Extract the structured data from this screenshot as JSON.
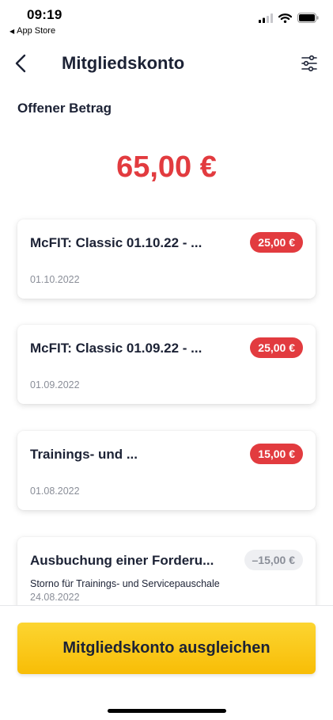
{
  "status_bar": {
    "time": "09:19",
    "back_app": "App Store",
    "icons": [
      "cellular-signal-icon",
      "wifi-icon",
      "battery-icon"
    ]
  },
  "nav": {
    "title": "Mitgliedskonto",
    "back_icon": "chevron-left-icon",
    "filter_icon": "sliders-icon"
  },
  "summary": {
    "label": "Offener Betrag",
    "amount": "65,00 €"
  },
  "transactions": [
    {
      "title": "McFIT: Classic 01.10.22 - ...",
      "amount": "25,00 €",
      "date": "01.10.2022",
      "status": "open"
    },
    {
      "title": "McFIT: Classic 01.09.22 - ...",
      "amount": "25,00 €",
      "date": "01.09.2022",
      "status": "open"
    },
    {
      "title": "Trainings- und ...",
      "amount": "15,00 €",
      "date": "01.08.2022",
      "status": "open"
    },
    {
      "title": "Ausbuchung einer Forderu...",
      "amount": "–15,00 €",
      "subtitle": "Storno für Trainings- und Servicepauschale",
      "date": "24.08.2022",
      "status": "credit"
    }
  ],
  "cta": {
    "label": "Mitgliedskonto ausgleichen"
  },
  "colors": {
    "accent_red": "#e23b3f",
    "cta_yellow": "#f8bd06",
    "text_dark": "#1c2235",
    "text_muted": "#8a8e98"
  }
}
